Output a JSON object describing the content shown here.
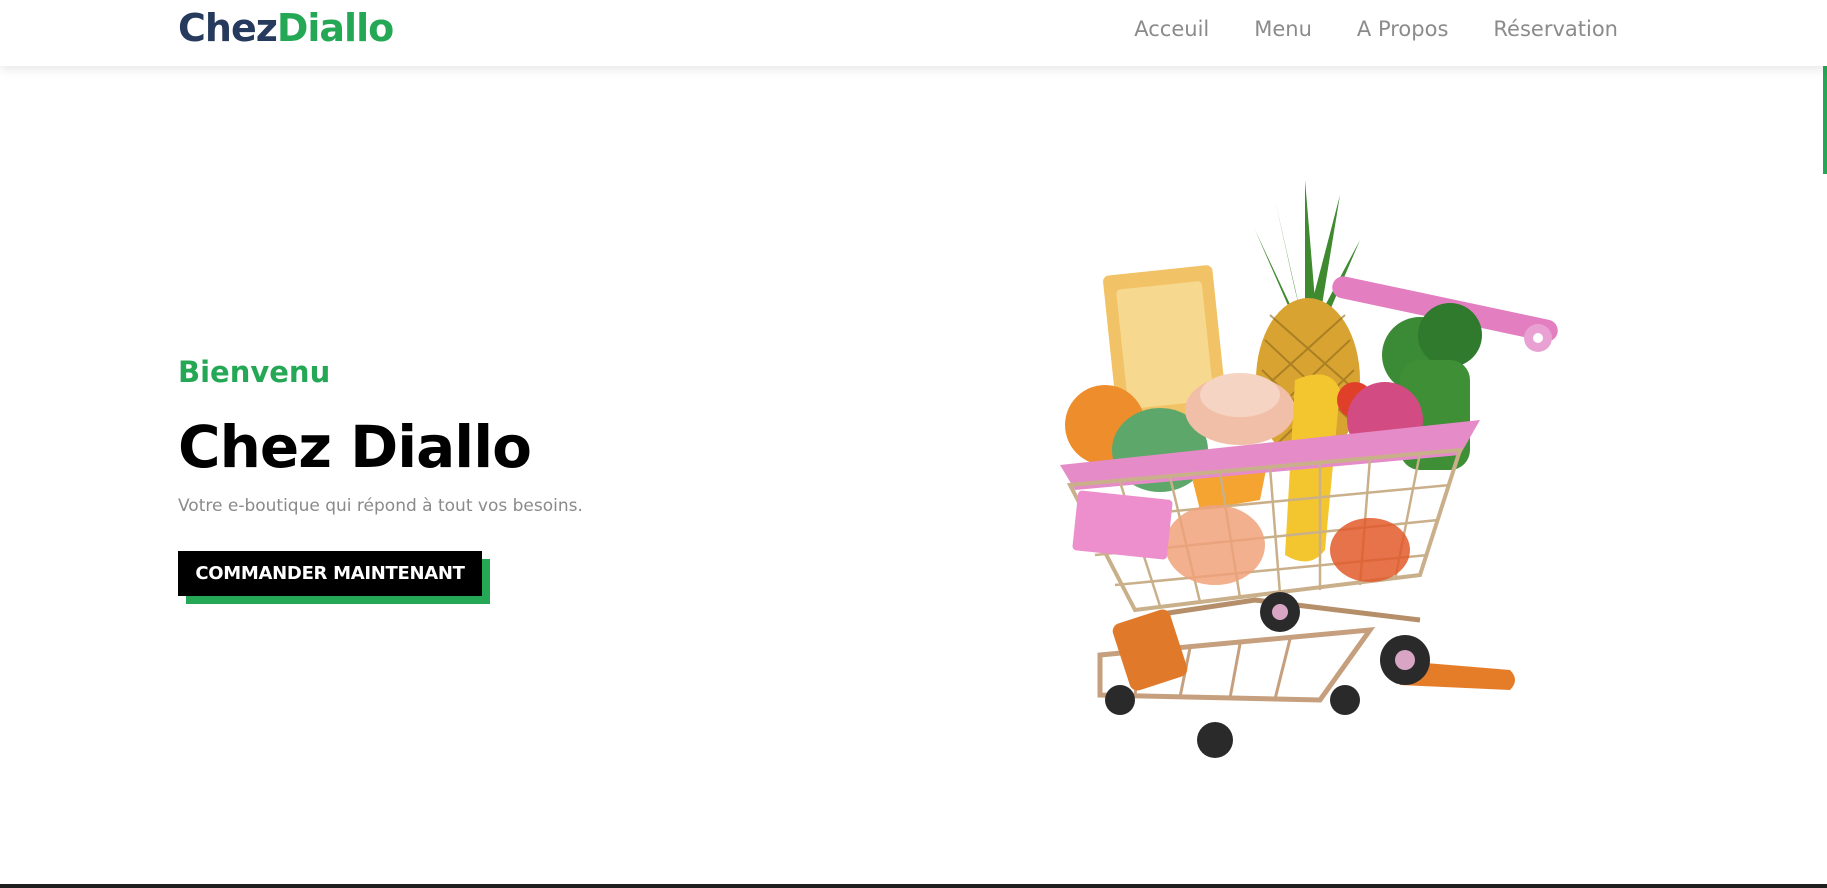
{
  "brand": {
    "part1": "Chez",
    "part2": "Diallo"
  },
  "nav": {
    "items": [
      "Acceuil",
      "Menu",
      "A Propos",
      "Réservation"
    ]
  },
  "hero": {
    "greeting": "Bienvenu",
    "title": "Chez Diallo",
    "subtitle": "Votre e-boutique qui répond à tout vos besoins.",
    "cta_label": "COMMANDER MAINTENANT",
    "image_icon": "shopping-cart-with-groceries"
  },
  "colors": {
    "brand_dark": "#253a5c",
    "accent": "#24a855",
    "cta_bg": "#000000",
    "nav_text": "#8b8b8b"
  }
}
